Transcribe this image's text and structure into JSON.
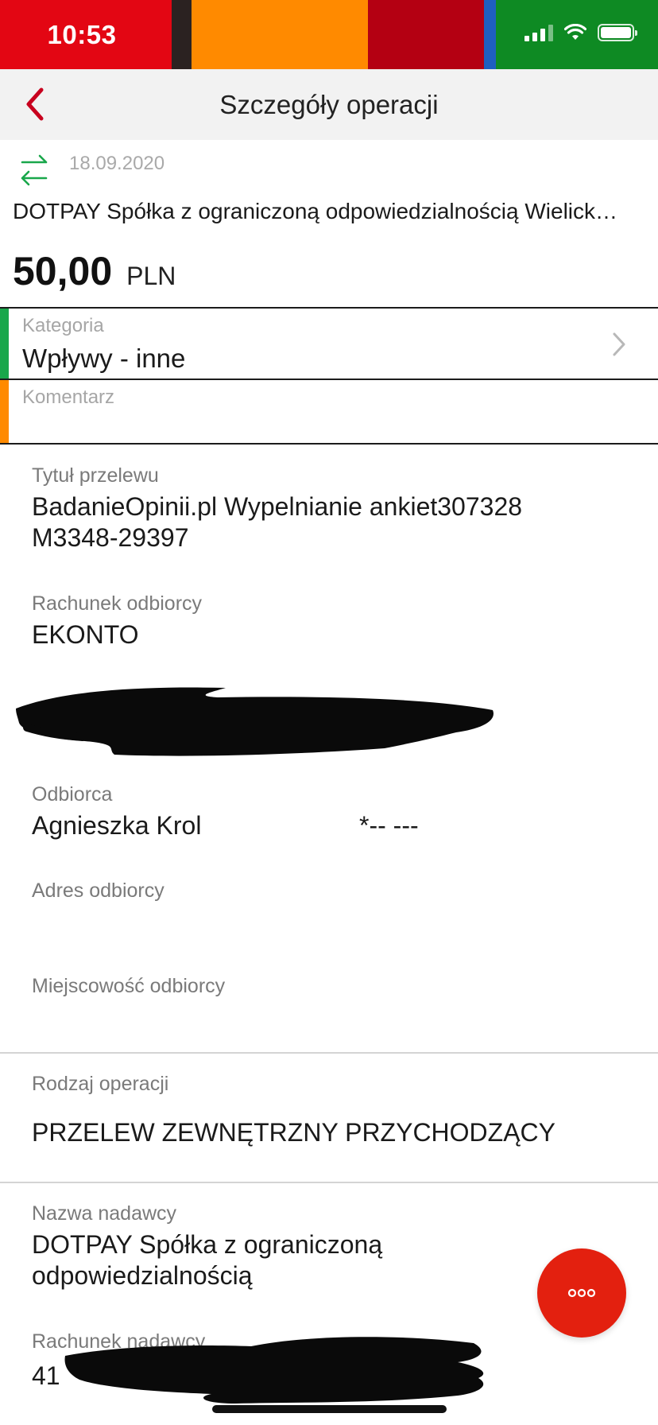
{
  "status_bar": {
    "time": "10:53",
    "icons": [
      "cellular-signal-icon",
      "wifi-icon",
      "battery-icon"
    ],
    "segment_colors": [
      "#e30613",
      "#2b2221",
      "#ff8a00",
      "#b40012",
      "#1f5fbf",
      "#0e8a23"
    ]
  },
  "nav": {
    "title": "Szczegóły operacji",
    "back_icon": "chevron-left-icon",
    "accent_color": "#c8001e"
  },
  "transaction": {
    "icon": "transfer-arrows-icon",
    "date": "18.09.2020",
    "name": "DOTPAY Spółka z ograniczoną odpowiedzialnością Wielick…",
    "amount": "50,00",
    "currency": "PLN"
  },
  "category": {
    "label": "Kategoria",
    "value": "Wpływy - inne",
    "accent_color": "#19a74b"
  },
  "comment": {
    "label": "Komentarz",
    "value": "",
    "accent_color": "#ff8a00"
  },
  "details": {
    "title_label": "Tytuł przelewu",
    "title_line1": "BadanieOpinii.pl Wypelnianie ankiet307328",
    "title_line2": "M3348-29397",
    "recipient_account_label": "Rachunek odbiorcy",
    "recipient_account_value": "EKONTO",
    "recipient_label": "Odbiorca",
    "recipient_name": "Agnieszka Krol",
    "recipient_extra": "*-- ---",
    "recipient_address_label": "Adres odbiorcy",
    "recipient_city_label": "Miejscowość odbiorcy",
    "operation_type_label": "Rodzaj operacji",
    "operation_type_value": "PRZELEW ZEWNĘTRZNY PRZYCHODZĄCY",
    "sender_name_label": "Nazwa nadawcy",
    "sender_name_line1": "DOTPAY  Spółka z ograniczoną",
    "sender_name_line2": "odpowiedzialnością",
    "sender_account_label": "Rachunek nadawcy",
    "sender_account_prefix": "41"
  },
  "fab": {
    "icon": "more-dots-icon",
    "color": "#e3200f"
  }
}
